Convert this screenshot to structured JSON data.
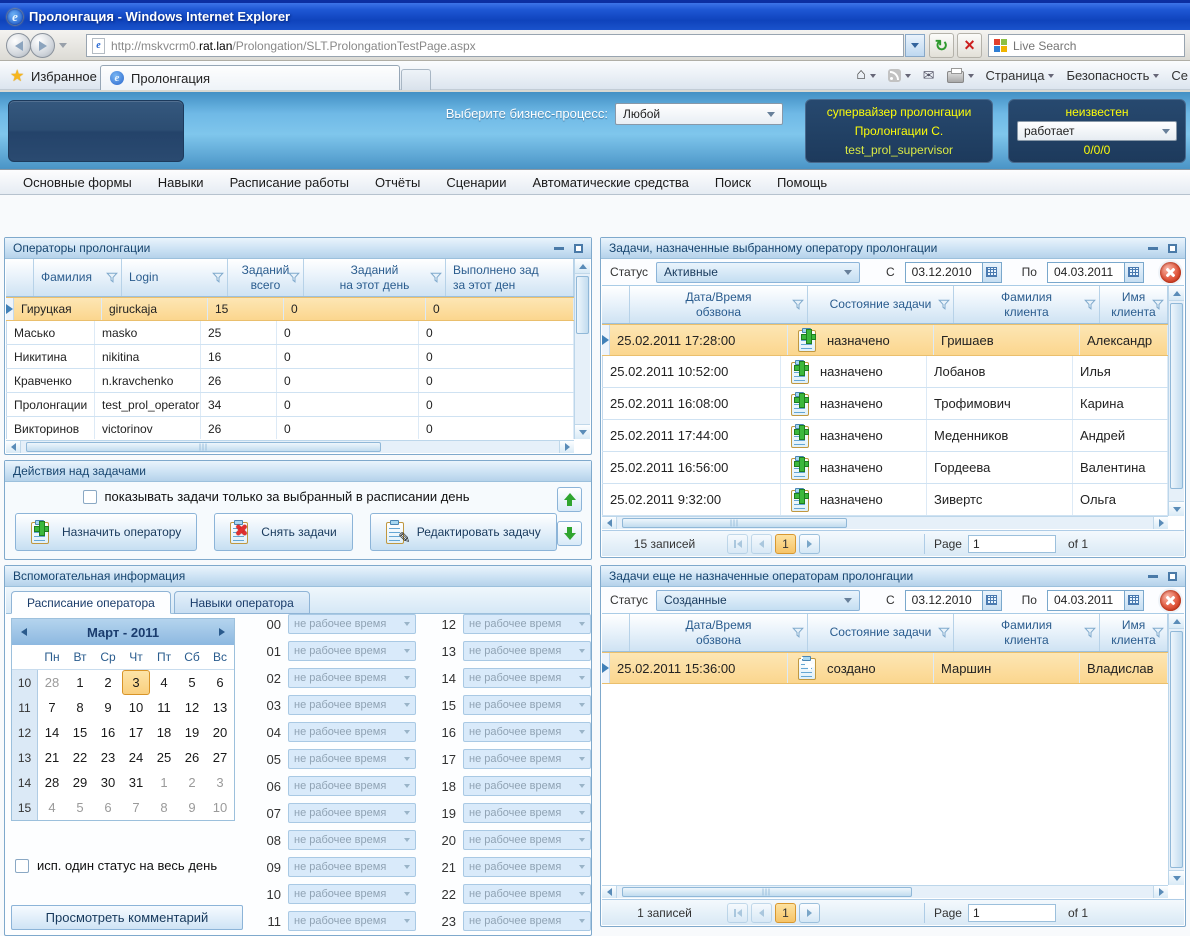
{
  "colors": {
    "titlebar_blue": "#1e57d4",
    "header_blue": "#6fb9e6",
    "panel_border": "#7fa9cc",
    "selection_orange": "#fbd68e",
    "accent_yellow": "#fdfd0a",
    "icon_green": "#3cb83c"
  },
  "icons": {
    "ie_logo": "e",
    "star": "★",
    "home": "⌂",
    "mail": "✉",
    "refresh": "↻",
    "stop": "×",
    "pen": "✎"
  },
  "browser": {
    "title": "Пролонгация - Windows Internet Explorer",
    "url_prefix": "http://mskvcrm0.",
    "url_domain": "rat.lan",
    "url_path": "/Prolongation/SLT.ProlongationTestPage.aspx",
    "search_placeholder": "Live Search",
    "favorites": "Избранное",
    "tab": "Пролонгация",
    "page_menu": "Страница",
    "security_menu": "Безопасность",
    "service_menu": "Се"
  },
  "header": {
    "bp_label": "Выберите бизнес-процесс:",
    "bp_value": "Любой",
    "supervisor_role": "супервайзер пролонгации",
    "supervisor_name": "Пролонгации С.",
    "supervisor_login": "test_prol_supervisor",
    "status_title": "неизвестен",
    "status_value": "работает",
    "status_counters": "0/0/0"
  },
  "menu": {
    "items": [
      "Основные формы",
      "Навыки",
      "Расписание работы",
      "Отчёты",
      "Сценарии",
      "Автоматические средства",
      "Поиск",
      "Помощь"
    ]
  },
  "operators_panel": {
    "title": "Операторы пролонгации",
    "col_surname": "Фамилия",
    "col_login": "Login",
    "col_total_1": "Заданий",
    "col_total_2": "всего",
    "col_day_1": "Заданий",
    "col_day_2": "на этот день",
    "col_done_1": "Выполнено зад",
    "col_done_2": "за этот ден",
    "rows": [
      {
        "surname": "Гируцкая",
        "login": "giruckaja",
        "total": "15",
        "day": "0",
        "done": "0"
      },
      {
        "surname": "Масько",
        "login": "masko",
        "total": "25",
        "day": "0",
        "done": "0"
      },
      {
        "surname": "Никитина",
        "login": "nikitina",
        "total": "16",
        "day": "0",
        "done": "0"
      },
      {
        "surname": "Кравченко",
        "login": "n.kravchenko",
        "total": "26",
        "day": "0",
        "done": "0"
      },
      {
        "surname": "Пролонгации",
        "login": "test_prol_operator",
        "total": "34",
        "day": "0",
        "done": "0"
      },
      {
        "surname": "Викторинов",
        "login": "victorinov",
        "total": "26",
        "day": "0",
        "done": "0"
      }
    ]
  },
  "actions_panel": {
    "title": "Действия над задачами",
    "checkbox_label": "показывать задачи только за выбранный в расписании день",
    "assign_button": "Назначить оператору",
    "remove_button": "Снять задачи",
    "edit_button": "Редактировать задачу"
  },
  "info_panel": {
    "title": "Вспомогательная информация",
    "tab_schedule": "Расписание оператора",
    "tab_skills": "Навыки оператора",
    "calendar": {
      "title": "Март - 2011",
      "weekdays": [
        "Пн",
        "Вт",
        "Ср",
        "Чт",
        "Пт",
        "Сб",
        "Вс"
      ],
      "weeks": [
        {
          "num": "10",
          "days": [
            "28",
            "1",
            "2",
            "3",
            "4",
            "5",
            "6"
          ]
        },
        {
          "num": "11",
          "days": [
            "7",
            "8",
            "9",
            "10",
            "11",
            "12",
            "13"
          ]
        },
        {
          "num": "12",
          "days": [
            "14",
            "15",
            "16",
            "17",
            "18",
            "19",
            "20"
          ]
        },
        {
          "num": "13",
          "days": [
            "21",
            "22",
            "23",
            "24",
            "25",
            "26",
            "27"
          ]
        },
        {
          "num": "14",
          "days": [
            "28",
            "29",
            "30",
            "31",
            "1",
            "2",
            "3"
          ]
        },
        {
          "num": "15",
          "days": [
            "4",
            "5",
            "6",
            "7",
            "8",
            "9",
            "10"
          ]
        }
      ]
    },
    "one_status_label": "исп. один статус на весь день",
    "comment_button": "Просмотреть комментарий",
    "slot_value": "не рабочее время",
    "hours_left": [
      "00",
      "01",
      "02",
      "03",
      "04",
      "05",
      "06",
      "07",
      "08",
      "09",
      "10",
      "11"
    ],
    "hours_right": [
      "12",
      "13",
      "14",
      "15",
      "16",
      "17",
      "18",
      "19",
      "20",
      "21",
      "22",
      "23"
    ]
  },
  "assigned_panel": {
    "title": "Задачи, назначенные выбранному оператору пролонгации",
    "status_label": "Статус",
    "status_value": "Активные",
    "from_label": "С",
    "from_value": "03.12.2010",
    "to_label": "По",
    "to_value": "04.03.2011",
    "col_date_1": "Дата/Время",
    "col_date_2": "обзвона",
    "col_state": "Состояние задачи",
    "col_surname_1": "Фамилия",
    "col_surname_2": "клиента",
    "col_name_1": "Имя",
    "col_name_2": "клиента",
    "rows": [
      {
        "datetime": "25.02.2011 17:28:00",
        "state": "назначено",
        "surname": "Гришаев",
        "name": "Александр"
      },
      {
        "datetime": "25.02.2011 10:52:00",
        "state": "назначено",
        "surname": "Лобанов",
        "name": "Илья"
      },
      {
        "datetime": "25.02.2011 16:08:00",
        "state": "назначено",
        "surname": "Трофимович",
        "name": "Карина"
      },
      {
        "datetime": "25.02.2011 17:44:00",
        "state": "назначено",
        "surname": "Меденников",
        "name": "Андрей"
      },
      {
        "datetime": "25.02.2011 16:56:00",
        "state": "назначено",
        "surname": "Гордеева",
        "name": "Валентина"
      },
      {
        "datetime": "25.02.2011 9:32:00",
        "state": "назначено",
        "surname": "Зивертс",
        "name": "Ольга"
      }
    ],
    "footer": {
      "records": "15 записей",
      "page_label": "Page",
      "page_value": "1",
      "of_label": "of 1"
    }
  },
  "unassigned_panel": {
    "title": "Задачи еще не назначенные операторам пролонгации",
    "status_label": "Статус",
    "status_value": "Созданные",
    "from_label": "С",
    "from_value": "03.12.2010",
    "to_label": "По",
    "to_value": "04.03.2011",
    "col_date_1": "Дата/Время",
    "col_date_2": "обзвона",
    "col_state": "Состояние задачи",
    "col_surname_1": "Фамилия",
    "col_surname_2": "клиента",
    "col_name_1": "Имя",
    "col_name_2": "клиента",
    "rows": [
      {
        "datetime": "25.02.2011 15:36:00",
        "state": "создано",
        "surname": "Маршин",
        "name": "Владислав"
      }
    ],
    "footer": {
      "records": "1 записей",
      "page_label": "Page",
      "page_value": "1",
      "of_label": "of 1"
    }
  }
}
